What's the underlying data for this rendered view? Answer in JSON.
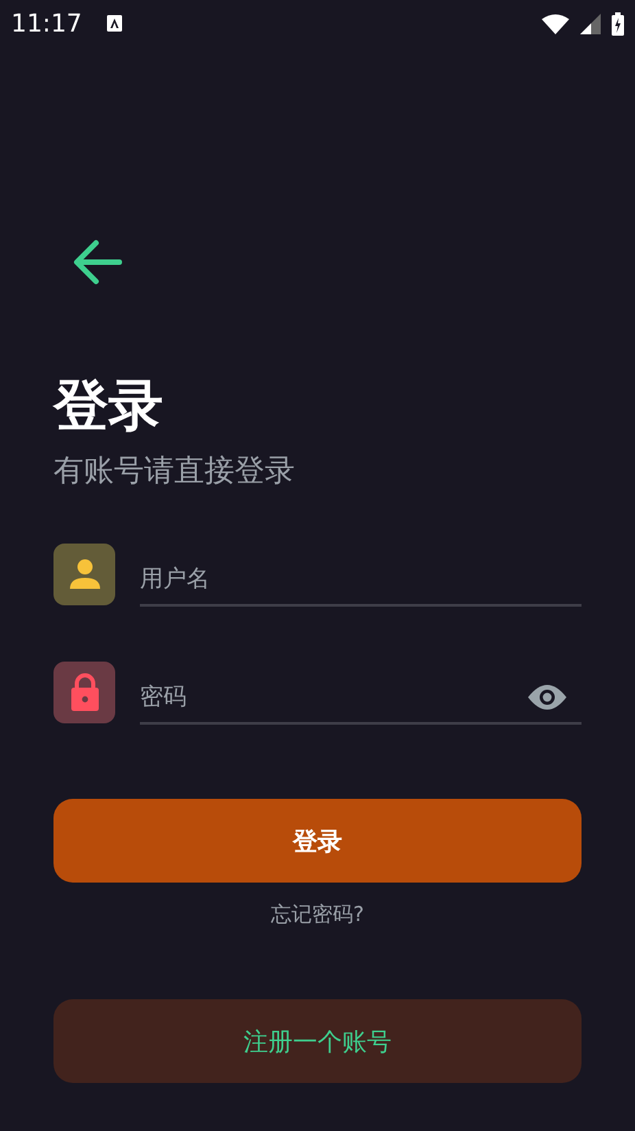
{
  "status_bar": {
    "time": "11:17"
  },
  "title": "登录",
  "subtitle": "有账号请直接登录",
  "fields": [
    {
      "kind": "user",
      "placeholder": "用户名"
    },
    {
      "kind": "password",
      "placeholder": "密码"
    }
  ],
  "login_button": "登录",
  "forgot_link": "忘记密码?",
  "register_button": "注册一个账号"
}
